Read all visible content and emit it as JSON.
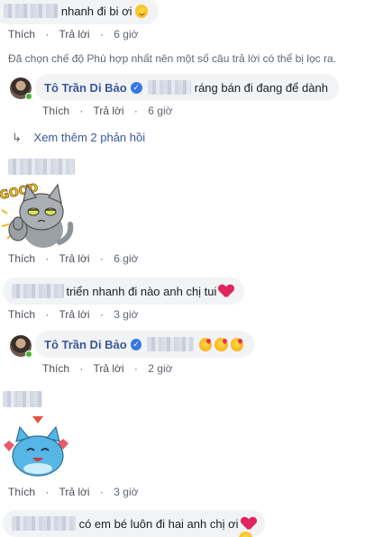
{
  "actions": {
    "like": "Thích",
    "reply": "Trả lời"
  },
  "comments": [
    {
      "text": "nhanh đi bi ơi",
      "time": "6 giờ"
    },
    {
      "author": "Tô Trần Di Bảo",
      "text": "ráng bán đi đang để dành",
      "time": "6 giờ"
    },
    {
      "time": "6 giờ"
    },
    {
      "text": "triển nhanh đi nào anh chị tui",
      "time": "3 giờ"
    },
    {
      "author": "Tô Trần Di Bảo",
      "time": "2 giờ"
    },
    {
      "time": "3 giờ"
    },
    {
      "text": "có em bé luôn đi hai anh chị ơi"
    }
  ],
  "filter_notice": "Đã chọn chế độ Phù hợp nhất nên một số câu trả lời có thể bị lọc ra.",
  "more_replies": "Xem thêm 2 phản hồi",
  "sticker_good_text": "GOOD",
  "icons": [
    "smile-emoji-icon",
    "verified-badge-icon",
    "reply-arrow-icon",
    "heart-emoji-icon",
    "kiss-emoji-icon"
  ],
  "colors": {
    "link": "#385898",
    "meta": "#606770",
    "bubble": "#f2f3f5",
    "heart": "#e0245e",
    "verified": "#3578e5"
  }
}
